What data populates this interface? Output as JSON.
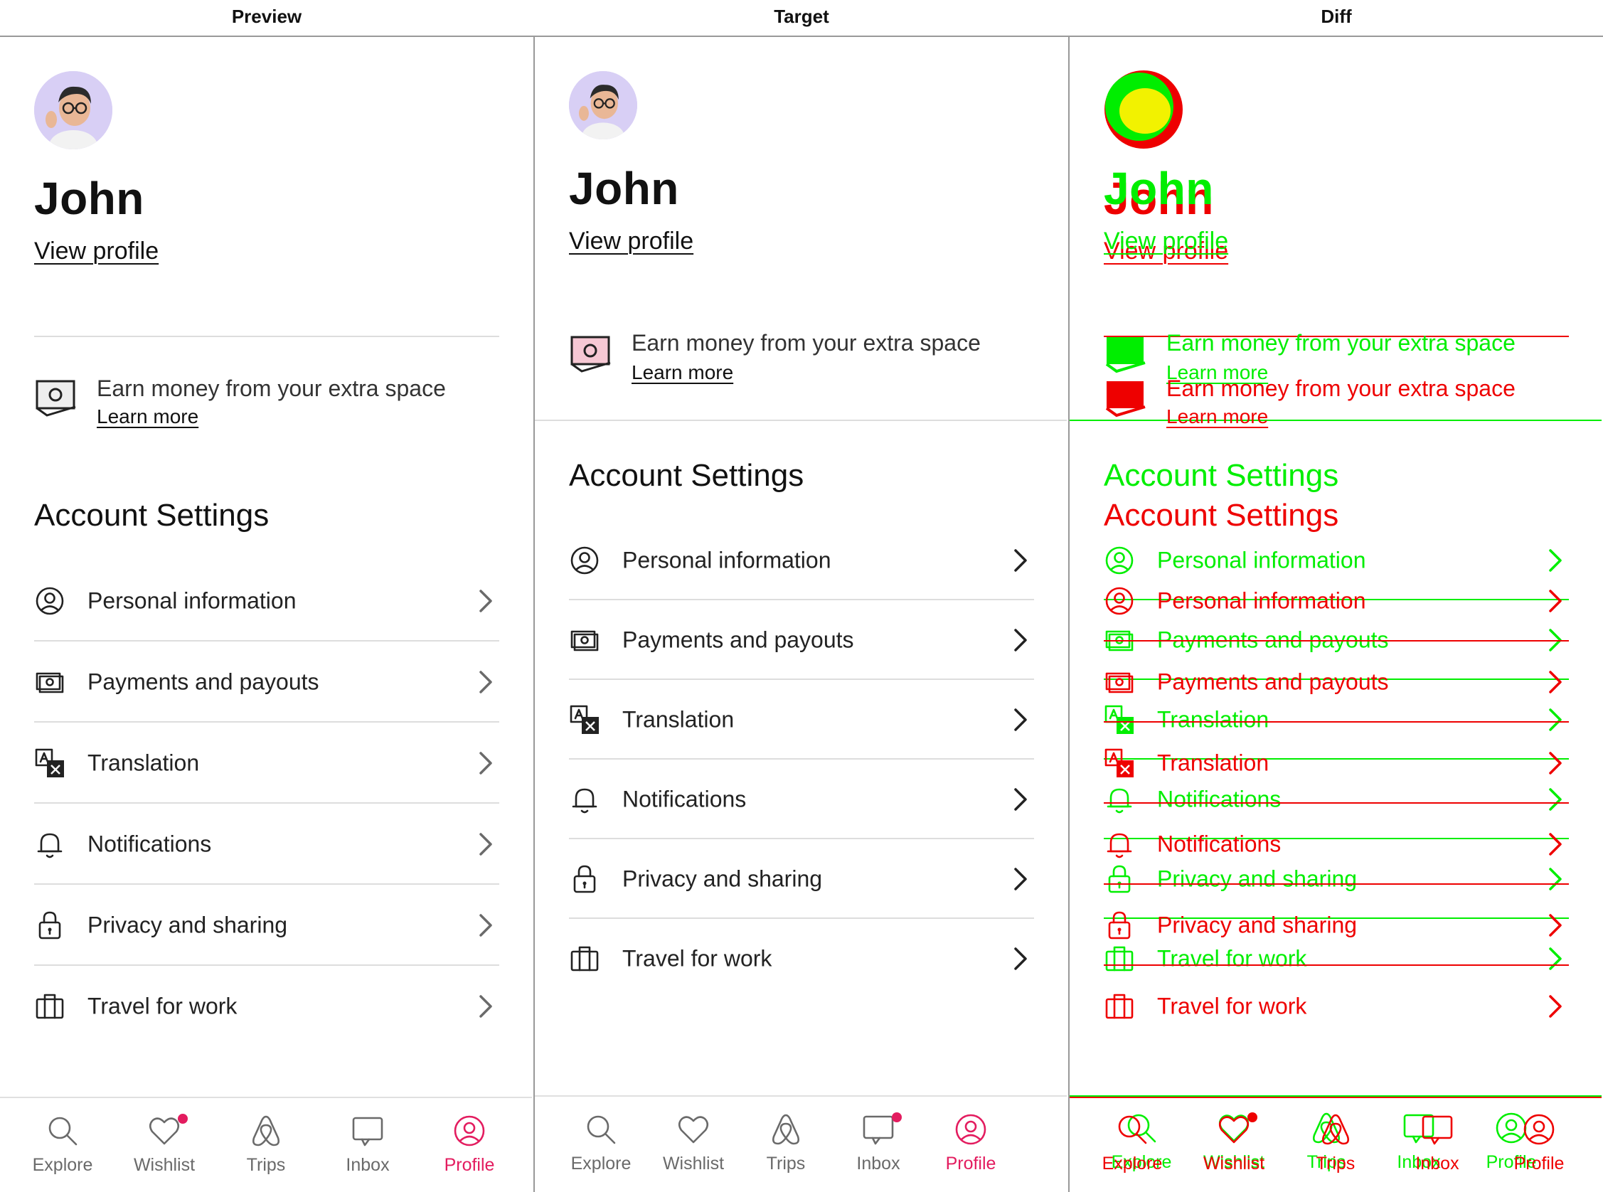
{
  "header": {
    "preview": "Preview",
    "target": "Target",
    "diff": "Diff"
  },
  "profile": {
    "name": "John",
    "view_profile": "View profile"
  },
  "earn": {
    "text": "Earn money from your extra space",
    "learn_more": "Learn more"
  },
  "settings": {
    "title": "Account Settings",
    "items": [
      {
        "label": "Personal information",
        "icon": "person-circle-icon"
      },
      {
        "label": "Payments and payouts",
        "icon": "payment-icon"
      },
      {
        "label": "Translation",
        "icon": "translation-icon"
      },
      {
        "label": "Notifications",
        "icon": "bell-icon"
      },
      {
        "label": "Privacy and sharing",
        "icon": "lock-icon"
      },
      {
        "label": "Travel for work",
        "icon": "briefcase-icon"
      }
    ]
  },
  "tabs": [
    {
      "label": "Explore",
      "icon": "search-icon",
      "active": false
    },
    {
      "label": "Wishlist",
      "icon": "heart-icon",
      "active": false
    },
    {
      "label": "Trips",
      "icon": "airbnb-logo-icon",
      "active": false
    },
    {
      "label": "Inbox",
      "icon": "message-icon",
      "active": false
    },
    {
      "label": "Profile",
      "icon": "profile-icon",
      "active": true
    }
  ],
  "colors": {
    "accent": "#e31c5f",
    "diff_green": "#00ee00",
    "diff_red": "#ee0000",
    "divider": "#dddddd"
  }
}
